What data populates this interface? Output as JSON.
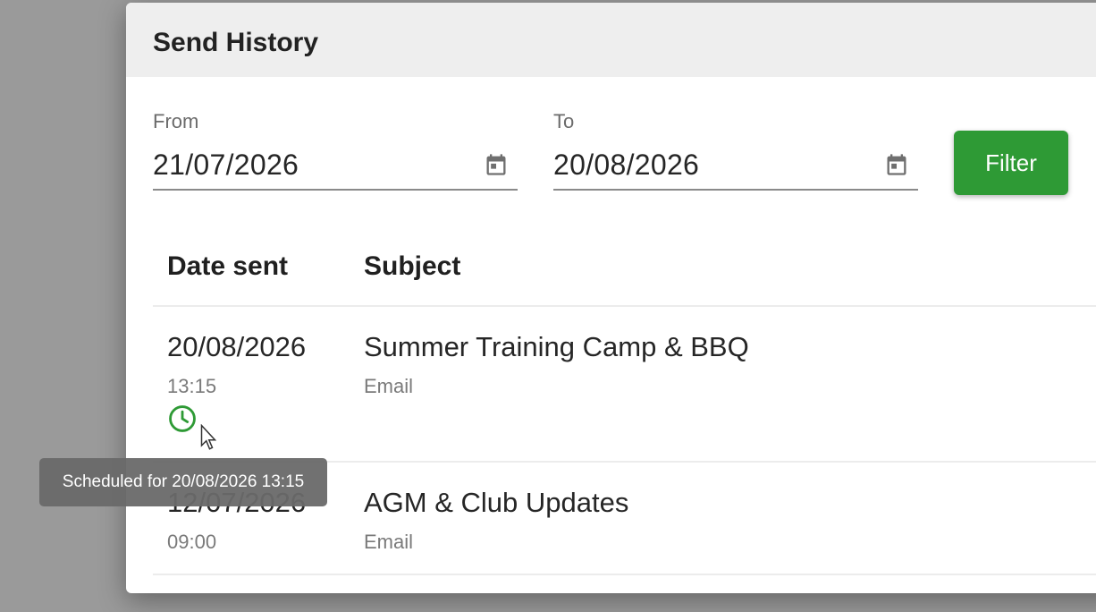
{
  "dialog": {
    "title": "Send History"
  },
  "filters": {
    "from_label": "From",
    "from_value": "21/07/2026",
    "to_label": "To",
    "to_value": "20/08/2026",
    "filter_button": "Filter"
  },
  "table": {
    "columns": [
      "Date sent",
      "Subject"
    ],
    "rows": [
      {
        "date": "20/08/2026",
        "time": "13:15",
        "subject": "Summer Training Camp & BBQ",
        "channel": "Email",
        "scheduled_icon": "clock-icon"
      },
      {
        "date": "12/07/2026",
        "time": "09:00",
        "subject": "AGM & Club Updates",
        "channel": "Email"
      }
    ]
  },
  "tooltip": {
    "text": "Scheduled for 20/08/2026 13:15"
  },
  "colors": {
    "accent": "#2e9a35",
    "header_bg": "#eeeeee",
    "tooltip_bg": "#696969"
  }
}
